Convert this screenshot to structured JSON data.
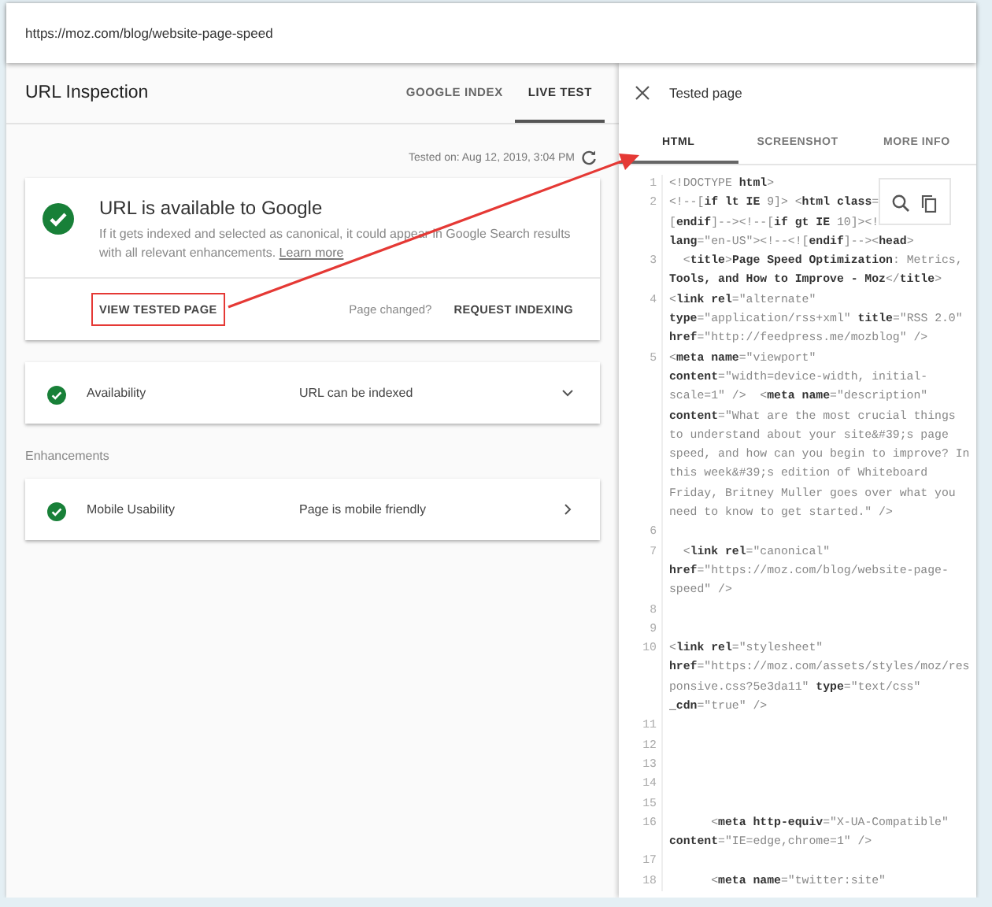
{
  "address_bar": {
    "url": "https://moz.com/blog/website-page-speed"
  },
  "inspection": {
    "title": "URL Inspection",
    "tabs": [
      {
        "label": "GOOGLE INDEX",
        "selected": false
      },
      {
        "label": "LIVE TEST",
        "selected": true
      }
    ],
    "tested_on": "Tested on: Aug 12, 2019, 3:04 PM",
    "status_card": {
      "title": "URL is available to Google",
      "description": "If it gets indexed and selected as canonical, it could appear in Google Search results with all relevant enhancements.",
      "link": "Learn more",
      "actions": [
        {
          "kind": "button",
          "label": "VIEW TESTED PAGE",
          "highlighted": true
        },
        {
          "kind": "note",
          "label": "Page changed?"
        },
        {
          "kind": "button",
          "label": "REQUEST INDEXING",
          "highlighted": false
        }
      ]
    },
    "sections": [
      {
        "rows": [
          {
            "kind": "expandable",
            "label": "Availability",
            "value": "URL can be indexed"
          }
        ]
      },
      {
        "heading": "Enhancements",
        "rows": [
          {
            "kind": "link",
            "label": "Mobile Usability",
            "value": "Page is mobile friendly"
          }
        ]
      }
    ]
  },
  "tested_page": {
    "title": "Tested page",
    "tabs": [
      {
        "label": "HTML",
        "selected": true
      },
      {
        "label": "SCREENSHOT",
        "selected": false
      },
      {
        "label": "MORE INFO",
        "selected": false
      }
    ],
    "code_lines": [
      {
        "number": "1",
        "rows": [
          "<!DOCTYPE **html**>"
        ]
      },
      {
        "number": "2",
        "rows": [
          "<!--[**if lt IE** 9]> <**html class**=",
          "[**endif**]--><!--[**if gt IE** 10]><!",
          "**lang**=\"en-US\"><!--<![**endif**]--><**head**>"
        ]
      },
      {
        "number": "3",
        "rows": [
          "  <**title**>**Page Speed Optimization**: Metrics,",
          "**Tools, and How to Improve - Moz**</**title**>"
        ]
      },
      {
        "number": "4",
        "rows": [
          "<**link rel**=\"alternate\"",
          "**type**=\"application/rss+xml\" **title**=\"RSS 2.0\"",
          "**href**=\"http://feedpress.me/mozblog\" />"
        ]
      },
      {
        "number": "5",
        "rows": [
          "<**meta name**=\"viewport\"",
          "**content**=\"width=device-width, initial-",
          "scale=1\" />  <**meta name**=\"description\"",
          "**content**=\"What are the most crucial things",
          "to understand about your site&#39;s page",
          "speed, and how can you begin to improve? In",
          "this week&#39;s edition of Whiteboard",
          "Friday, Britney Muller goes over what you",
          "need to know to get started.\" />"
        ]
      },
      {
        "number": "6"
      },
      {
        "number": "7",
        "rows": [
          "  <**link rel**=\"canonical\"",
          "**href**=\"https://moz.com/blog/website-page-",
          "speed\" />"
        ]
      },
      {
        "number": "8"
      },
      {
        "number": "9"
      },
      {
        "number": "10",
        "rows": [
          "<**link rel**=\"stylesheet\"",
          "**href**=\"https://moz.com/assets/styles/moz/res",
          "ponsive.css?5e3da11\" **type**=\"text/css\"",
          "**_cdn**=\"true\" />"
        ]
      },
      {
        "number": "11"
      },
      {
        "number": "12"
      },
      {
        "number": "13"
      },
      {
        "number": "14"
      },
      {
        "number": "15"
      },
      {
        "number": "16",
        "rows": [
          "      <**meta http-equiv**=\"X-UA-Compatible\"",
          "**content**=\"IE=edge,chrome=1\" />"
        ]
      },
      {
        "number": "17"
      },
      {
        "number": "18",
        "rows": [
          "      <**meta name**=\"twitter:site\""
        ]
      }
    ]
  },
  "annotation": {
    "arrow": true
  }
}
